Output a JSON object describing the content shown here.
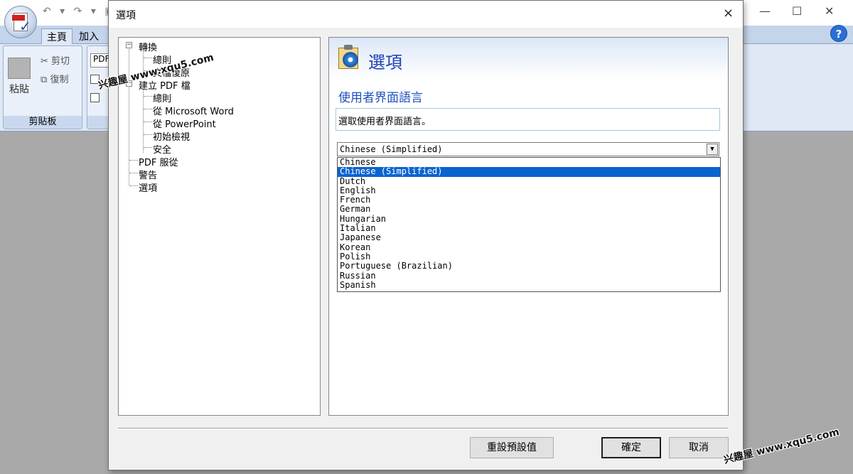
{
  "app": {
    "tabs": [
      "主頁",
      "加入"
    ],
    "clipboard": {
      "paste_label": "粘貼",
      "cut_label": "剪切",
      "copy_label": "復制",
      "group_label": "剪貼板"
    },
    "second_group": {
      "combo_value": "PDF"
    },
    "help_label": "?"
  },
  "watermark": {
    "text": "兴趣屋 www.xqu5.com"
  },
  "dialog": {
    "title": "選項",
    "close_label": "×",
    "tree": [
      {
        "label": "轉換",
        "level": 0,
        "expander": "−"
      },
      {
        "label": "總則",
        "level": 1
      },
      {
        "label": "文檔復原",
        "level": 1
      },
      {
        "label": "建立 PDF 檔",
        "level": 0,
        "expander": "−"
      },
      {
        "label": "總則",
        "level": 1
      },
      {
        "label": "從 Microsoft Word",
        "level": 1
      },
      {
        "label": "從 PowerPoint",
        "level": 1
      },
      {
        "label": "初始檢視",
        "level": 1
      },
      {
        "label": "安全",
        "level": 1
      },
      {
        "label": "PDF 服從",
        "level": 0
      },
      {
        "label": "警告",
        "level": 0
      },
      {
        "label": "選項",
        "level": 0
      }
    ],
    "content": {
      "header_title": "選項",
      "section_title": "使用者界面語言",
      "description": "選取使用者界面語言。",
      "language_select": {
        "selected": "Chinese (Simplified)",
        "options": [
          "Chinese",
          "Chinese (Simplified)",
          "Dutch",
          "English",
          "French",
          "German",
          "Hungarian",
          "Italian",
          "Japanese",
          "Korean",
          "Polish",
          "Portuguese (Brazilian)",
          "Russian",
          "Spanish"
        ]
      }
    },
    "buttons": {
      "reset": "重設預設值",
      "ok": "確定",
      "cancel": "取消"
    }
  }
}
